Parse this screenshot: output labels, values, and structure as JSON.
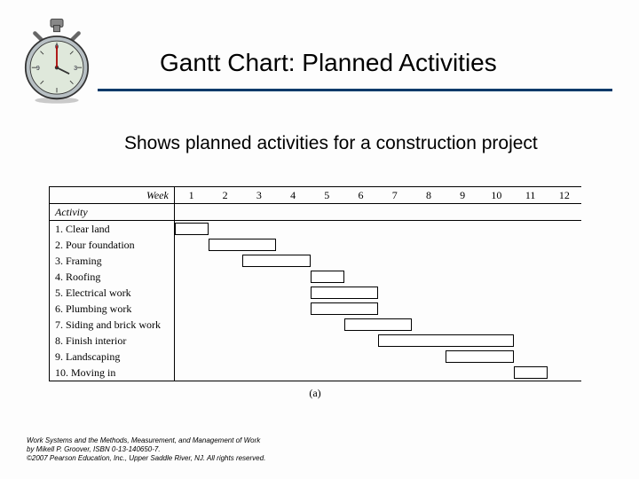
{
  "header": {
    "title": "Gantt Chart: Planned Activities"
  },
  "subtitle": "Shows planned activities for a construction project",
  "chart_data": {
    "type": "bar",
    "title": "",
    "xlabel": "Week",
    "ylabel": "Activity",
    "categories": [
      "1",
      "2",
      "3",
      "4",
      "5",
      "6",
      "7",
      "8",
      "9",
      "10",
      "11",
      "12"
    ],
    "xlim": [
      0.5,
      12.5
    ],
    "series": [
      {
        "name": "1. Clear land",
        "start": 1,
        "end": 2
      },
      {
        "name": "2. Pour foundation",
        "start": 2,
        "end": 4
      },
      {
        "name": "3. Framing",
        "start": 3,
        "end": 5
      },
      {
        "name": "4. Roofing",
        "start": 5,
        "end": 6
      },
      {
        "name": "5. Electrical work",
        "start": 5,
        "end": 7
      },
      {
        "name": "6. Plumbing work",
        "start": 5,
        "end": 7
      },
      {
        "name": "7. Siding and brick work",
        "start": 6,
        "end": 8
      },
      {
        "name": "8. Finish interior",
        "start": 7,
        "end": 11
      },
      {
        "name": "9. Landscaping",
        "start": 9,
        "end": 11
      },
      {
        "name": "10. Moving in",
        "start": 11,
        "end": 12
      }
    ],
    "caption": "(a)"
  },
  "footer": {
    "line1": "Work Systems and the Methods, Measurement, and Management of Work",
    "line2": "by Mikell P. Groover, ISBN 0-13-140650-7.",
    "line3": "©2007 Pearson Education, Inc., Upper Saddle River, NJ.  All rights reserved."
  }
}
